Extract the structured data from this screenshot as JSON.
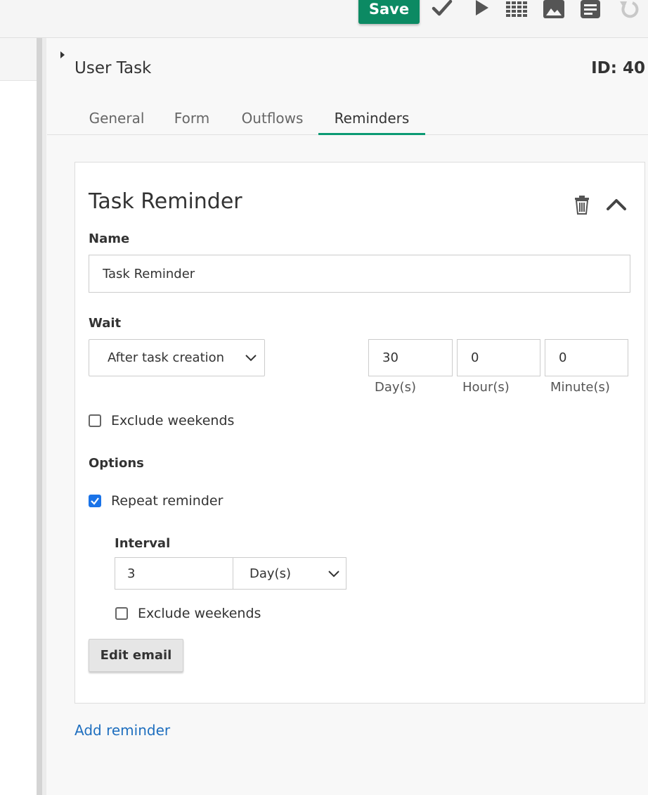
{
  "toolbar": {
    "save_label": "Save",
    "icons": [
      "check-icon",
      "play-icon",
      "grid-icon",
      "image-icon",
      "document-icon",
      "undo-icon"
    ]
  },
  "panel": {
    "title": "User Task",
    "id_label": "ID: 40"
  },
  "tabs": [
    {
      "label": "General",
      "active": false
    },
    {
      "label": "Form",
      "active": false
    },
    {
      "label": "Outflows",
      "active": false
    },
    {
      "label": "Reminders",
      "active": true
    }
  ],
  "reminder": {
    "title": "Task Reminder",
    "name_label": "Name",
    "name_value": "Task Reminder",
    "wait_label": "Wait",
    "wait_selected": "After task creation",
    "days_value": "30",
    "hours_value": "0",
    "minutes_value": "0",
    "days_label": "Day(s)",
    "hours_label": "Hour(s)",
    "minutes_label": "Minute(s)",
    "exclude_weekends_label": "Exclude weekends",
    "exclude_weekends_checked": false,
    "options_label": "Options",
    "repeat_label": "Repeat reminder",
    "repeat_checked": true,
    "interval_label": "Interval",
    "interval_value": "3",
    "interval_unit": "Day(s)",
    "interval_exclude_weekends_label": "Exclude weekends",
    "interval_exclude_weekends_checked": false,
    "edit_email_label": "Edit email"
  },
  "add_reminder_label": "Add reminder",
  "colors": {
    "accent": "#0c8a63",
    "tab_underline": "#0c9a73",
    "link": "#1f6fbf",
    "checkbox_checked": "#1a73e8"
  }
}
